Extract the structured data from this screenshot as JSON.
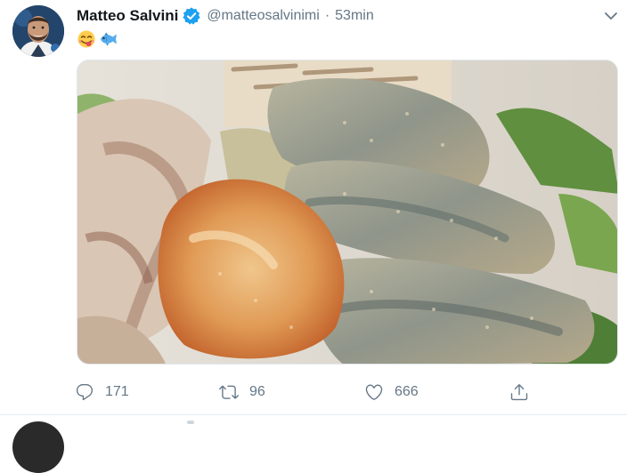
{
  "tweet": {
    "author_name": "Matteo Salvini",
    "handle": "@matteosalvinimi",
    "separator": "·",
    "time": "53min",
    "verified": true,
    "emojis": [
      "face-savoring-food-emoji",
      "fish-emoji"
    ],
    "actions": {
      "reply_count": "171",
      "retweet_count": "96",
      "like_count": "666"
    }
  },
  "colors": {
    "text_primary": "#14171a",
    "text_secondary": "#657786",
    "verified_blue": "#1da1f2",
    "divider": "#e6ecf0"
  },
  "icons": {
    "reply": "reply-icon",
    "retweet": "retweet-icon",
    "like": "heart-icon",
    "share": "share-icon",
    "menu": "chevron-down-icon",
    "verified": "verified-badge-icon"
  }
}
